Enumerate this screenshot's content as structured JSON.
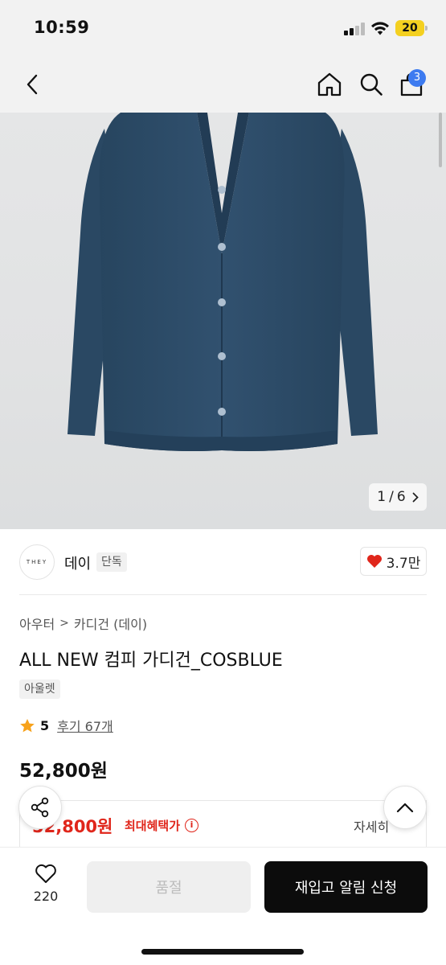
{
  "status_bar": {
    "time": "10:59",
    "battery": "20",
    "battery_color": "#f4d020"
  },
  "nav": {
    "back_icon": "chevron-left-icon",
    "home_icon": "home-icon",
    "search_icon": "search-icon",
    "cart_icon": "cart-icon",
    "cart_count": "3",
    "badge_color": "#3d7bf0"
  },
  "gallery": {
    "current": "1",
    "separator": "/",
    "total": "6",
    "next_icon": "chevron-right-icon",
    "product_color": "#2f4e6c"
  },
  "brand": {
    "logo_text": "THEY",
    "name": "데이",
    "tag": "단독",
    "like_count": "3.7만",
    "like_icon": "heart-filled-icon",
    "like_color": "#e0261b"
  },
  "breadcrumb": {
    "level1": "아우터",
    "separator": ">",
    "level2": "카디건 (데이)"
  },
  "product": {
    "title": "ALL NEW 컴피 가디건_COSBLUE",
    "tag": "아울렛",
    "rating": "5",
    "reviews": "후기 67개",
    "price": "52,800원"
  },
  "benefit": {
    "price": "52,800원",
    "label": "최대혜택가",
    "info_icon": "info-icon",
    "detail": "자세히",
    "accent": "#e0261b"
  },
  "floating": {
    "share_icon": "share-icon",
    "top_icon": "chevron-up-icon"
  },
  "bottom_bar": {
    "wish_icon": "heart-outline-icon",
    "wish_count": "220",
    "sold_out_label": "품절",
    "restock_label": "재입고 알림 신청"
  }
}
